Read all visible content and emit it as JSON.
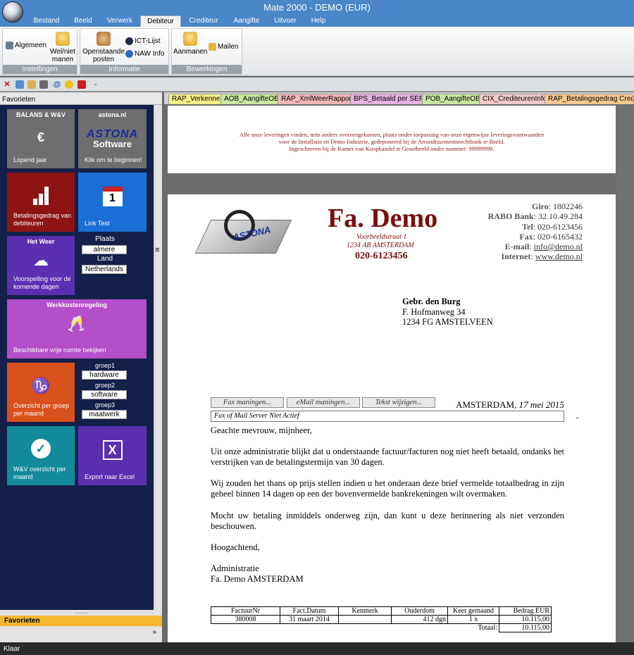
{
  "window": {
    "title": "Mate 2000 - DEMO (EUR)"
  },
  "ribbon_tabs": [
    "Bestand",
    "Beeld",
    "Verwerk",
    "Debiteur",
    "Crediteur",
    "Aangifte",
    "Uitvoer",
    "Help"
  ],
  "ribbon": {
    "instellingen": {
      "label": "Instellingen",
      "algemeen": "Algemeen",
      "wel_niet_1": "Wel/niet",
      "wel_niet_2": "manen"
    },
    "informatie": {
      "label": "Informatie",
      "open_1": "Openstaande",
      "open_2": "posten",
      "ict": "ICT-Lijst",
      "naw": "NAW Info"
    },
    "bewerkingen": {
      "label": "Bewerkingen",
      "aanmanen": "Aanmanen",
      "mailen": "Mailen"
    }
  },
  "left_panel": {
    "header": "Favorieten",
    "tiles": {
      "balans": {
        "title": "BALANS & W&V",
        "glyph": "€",
        "bottom": "Lopend jaar"
      },
      "astona": {
        "title": "astona.nl",
        "logo_1": "ASTONA",
        "logo_2": "Software",
        "bottom": "Klik om te beginnen!"
      },
      "betaling": {
        "bottom": "Betalingsgedrag van debiteuren"
      },
      "link": {
        "bottom": "Link Test",
        "cal_day": "1"
      },
      "weer": {
        "title": "Het Weer",
        "bottom": "Voorspelling voor de komende dagen",
        "plaats_label": "Plaats",
        "plaats_value": "almere",
        "land_label": "Land",
        "land_value": "Netherlands"
      },
      "wkr": {
        "title": "Werkkostenregeling",
        "bottom": "Beschikbare vrije ruimte bekijken"
      },
      "groep": {
        "glyph": "♑",
        "bottom": "Overzicht per groep per maand",
        "g1_label": "groep1",
        "g1_value": "hardware",
        "g2_label": "groep2",
        "g2_value": "software",
        "g3_label": "groep3",
        "g3_value": "maatwerk"
      },
      "wv": {
        "bottom": "W&V overzicht per maand"
      },
      "excel": {
        "bottom": "Export naar Excel",
        "glyph": "X"
      }
    },
    "footer_label": "Favorieten",
    "footer_dots": "........."
  },
  "doc_tabs": [
    {
      "label": "RAP_Verkenner",
      "color": "#f4f08a"
    },
    {
      "label": "AOB_AangifteOB",
      "color": "#c9e6a3"
    },
    {
      "label": "RAP_XmlWeerRapport",
      "color": "#f3b7b7"
    },
    {
      "label": "BPS_Betaald per SEPA",
      "color": "#e8b2e0"
    },
    {
      "label": "POB_AangifteOB",
      "color": "#c9e6a3"
    },
    {
      "label": "CIX_CrediteurenInfo",
      "color": "#f3c9c9"
    },
    {
      "label": "RAP_Betalingsgedrag Credite",
      "color": "#f7c98f"
    }
  ],
  "disclaimer": [
    "Alle onze leveringen vinden, mits anders overeengekomen, plaats onder toepassing van onze eigenwijze leveringsvoorwaarden",
    "voor de Installatie en Demo Industrie, gedeponeerd bij de Arrondissementsrechtbank te Beeld.",
    "Ingeschreven bij de Kamer van Koophandel te Grootbeeld onder nummer: 99999999."
  ],
  "letter": {
    "company": "Fa. Demo",
    "street": "Voorbeeldstraat 1",
    "city": "1234 AB  AMSTERDAM",
    "phone": "020-6123456",
    "logo_text": "ASTONA",
    "info": [
      {
        "k": "Giro",
        "v": "1802246"
      },
      {
        "k": "RABO Bank",
        "v": "32.10.49.284"
      },
      {
        "k": "Tel",
        "v": "020-6123456"
      },
      {
        "k": "Fax",
        "v": "020-6165432"
      },
      {
        "k": "E-mail",
        "v": "info@demo.nl"
      },
      {
        "k": "Internet",
        "v": "www.demo.nl"
      }
    ],
    "recipient": {
      "name": "Gebr. den Burg",
      "street": "F. Hofmanweg 34",
      "city": "1234 FG  AMSTELVEEN"
    },
    "buttons": {
      "fax": "Fax maningen...",
      "email": "eMail maningen...",
      "tekst": "Tekst wijzigen..."
    },
    "place": "AMSTERDAM,",
    "date": "17 mei 2015",
    "status_field": "Fax of Mail Server Niet Actief",
    "dash": "-",
    "salutation": "Geachte mevrouw, mijnheer,",
    "p1": "Uit onze administratie blijkt dat u onderstaande factuur/facturen nog niet heeft betaald, ondanks het verstrijken van de betalingstermijn van 30 dagen.",
    "p2": "Wij zouden het thans op prijs stellen indien u het onderaan deze brief vermelde totaalbedrag in zijn geheel binnen 14 dagen op een der bovenvermelde bankrekeningen wilt overmaken.",
    "p3": "Mocht uw betaling inmiddels onderweg zijn, dan kunt u deze herinnering als niet verzonden beschouwen.",
    "closing": "Hoogachtend,",
    "sign1": "Administratie",
    "sign2": "Fa. Demo AMSTERDAM",
    "table": {
      "headers": [
        "FactuurNr",
        "Fact.Datum",
        "Kenmerk",
        "Ouderdom",
        "Keer gemaand",
        "Bedrag EUR"
      ],
      "row": [
        "380008",
        "31 maart 2014",
        "",
        "412 dgn",
        "1 x",
        "10.115,00"
      ],
      "total_label": "Totaal:",
      "total": "10.115,00"
    }
  },
  "status": "Klaar"
}
